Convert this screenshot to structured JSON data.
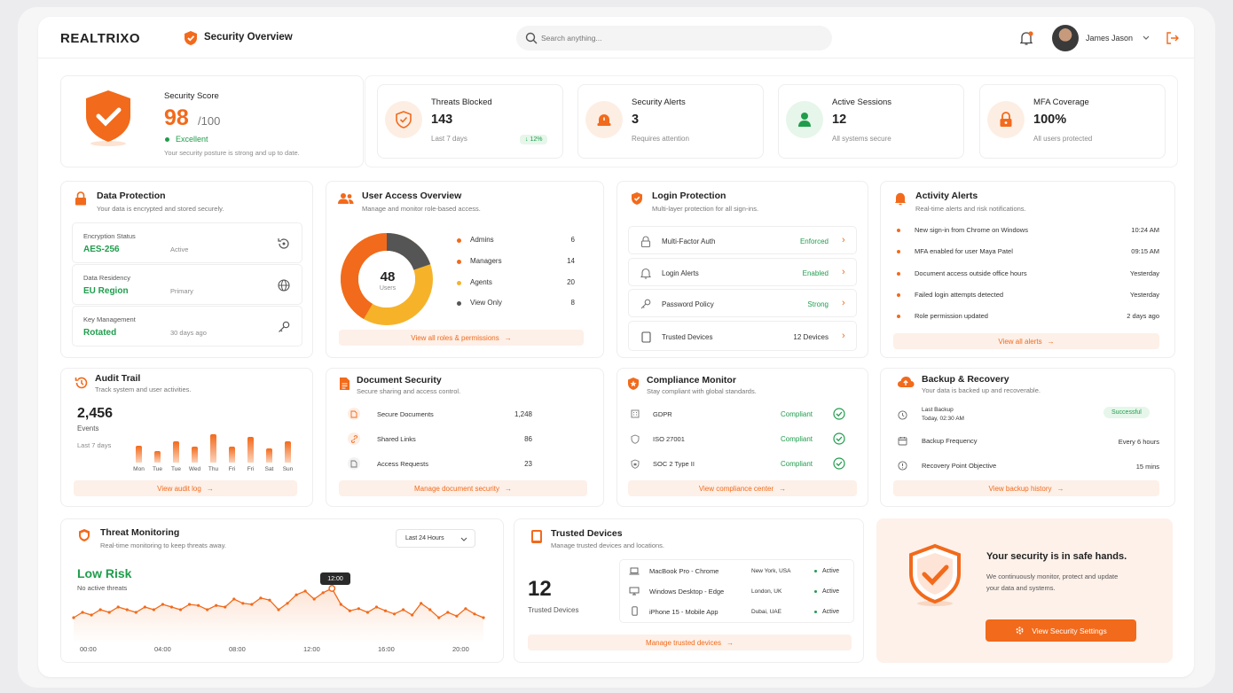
{
  "header": {
    "logo": "REALTRIXO",
    "page_title": "Security Overview",
    "search_placeholder": "Search anything...",
    "user_name": "James Jason"
  },
  "score": {
    "label": "Security Score",
    "value": "98",
    "max": "/100",
    "status": "Excellent",
    "note": "Your security posture is strong and up to date."
  },
  "stats": [
    {
      "title": "Threats Blocked",
      "value": "143",
      "sub": "Last 7 days",
      "badge": "↓ 12%"
    },
    {
      "title": "Security Alerts",
      "value": "3",
      "sub": "Requires attention"
    },
    {
      "title": "Active Sessions",
      "value": "12",
      "sub": "All systems secure"
    },
    {
      "title": "MFA Coverage",
      "value": "100%",
      "sub": "All users protected"
    }
  ],
  "data_protection": {
    "title": "Data Protection",
    "sub": "Your data is encrypted and stored securely.",
    "items": [
      {
        "label": "Encryption Status",
        "value": "AES-256",
        "meta": "Active"
      },
      {
        "label": "Data Residency",
        "value": "EU Region",
        "meta": "Primary"
      },
      {
        "label": "Key Management",
        "value": "Rotated",
        "meta": "30 days ago"
      }
    ]
  },
  "user_access": {
    "title": "User Access Overview",
    "sub": "Manage and monitor role-based access.",
    "total": "48",
    "total_label": "Users",
    "link": "View all roles & permissions",
    "roles": [
      {
        "name": "Admins",
        "count": "6",
        "color": "#f26a1b"
      },
      {
        "name": "Managers",
        "count": "14",
        "color": "#f26a1b"
      },
      {
        "name": "Agents",
        "count": "20",
        "color": "#f6b32a"
      },
      {
        "name": "View Only",
        "count": "8",
        "color": "#555555"
      }
    ]
  },
  "login": {
    "title": "Login Protection",
    "sub": "Multi-layer protection for all sign-ins.",
    "items": [
      {
        "label": "Multi-Factor Auth",
        "status": "Enforced"
      },
      {
        "label": "Login Alerts",
        "status": "Enabled"
      },
      {
        "label": "Password Policy",
        "status": "Strong"
      },
      {
        "label": "Trusted Devices",
        "status": "12 Devices"
      }
    ]
  },
  "activity": {
    "title": "Activity Alerts",
    "sub": "Real-time alerts and risk notifications.",
    "link": "View all alerts",
    "items": [
      {
        "text": "New sign-in from Chrome on Windows",
        "time": "10:24 AM"
      },
      {
        "text": "MFA enabled for user Maya Patel",
        "time": "09:15 AM"
      },
      {
        "text": "Document access outside office hours",
        "time": "Yesterday"
      },
      {
        "text": "Failed login attempts detected",
        "time": "Yesterday"
      },
      {
        "text": "Role permission updated",
        "time": "2 days ago"
      }
    ]
  },
  "audit": {
    "title": "Audit Trail",
    "sub": "Track system and user activities.",
    "count": "2,456",
    "count_label": "Events",
    "period": "Last 7 days",
    "link": "View audit log",
    "days": [
      "Mon",
      "Tue",
      "Tue",
      "Wed",
      "Thu",
      "Fri",
      "Fri",
      "Sat",
      "Sun"
    ],
    "values": [
      0.6,
      0.4,
      0.75,
      0.55,
      1.0,
      0.55,
      0.9,
      0.5,
      0.75
    ]
  },
  "documents": {
    "title": "Document Security",
    "sub": "Secure sharing and access control.",
    "link": "Manage document security",
    "items": [
      {
        "label": "Secure Documents",
        "value": "1,248"
      },
      {
        "label": "Shared Links",
        "value": "86"
      },
      {
        "label": "Access Requests",
        "value": "23"
      }
    ]
  },
  "compliance": {
    "title": "Compliance Monitor",
    "sub": "Stay compliant with global standards.",
    "link": "View compliance center",
    "items": [
      {
        "label": "GDPR",
        "status": "Compliant"
      },
      {
        "label": "ISO 27001",
        "status": "Compliant"
      },
      {
        "label": "SOC 2 Type II",
        "status": "Compliant"
      }
    ]
  },
  "backup": {
    "title": "Backup & Recovery",
    "sub": "Your data is backed up and recoverable.",
    "link": "View backup history",
    "last_label": "Last Backup",
    "last_time": "Today, 02:30 AM",
    "last_status": "Successful",
    "items": [
      {
        "label": "Backup Frequency",
        "value": "Every 6 hours"
      },
      {
        "label": "Recovery Point Objective",
        "value": "15 mins"
      }
    ]
  },
  "threat": {
    "title": "Threat Monitoring",
    "sub": "Real-time monitoring to keep threats away.",
    "range": "Last 24 Hours",
    "risk": "Low Risk",
    "risk_sub": "No active threats",
    "tooltip": "12:00",
    "x_labels": [
      "00:00",
      "04:00",
      "08:00",
      "12:00",
      "16:00",
      "20:00"
    ],
    "values": [
      0.35,
      0.45,
      0.4,
      0.5,
      0.45,
      0.55,
      0.5,
      0.45,
      0.55,
      0.5,
      0.6,
      0.55,
      0.5,
      0.6,
      0.58,
      0.5,
      0.58,
      0.55,
      0.7,
      0.62,
      0.6,
      0.72,
      0.68,
      0.5,
      0.62,
      0.78,
      0.85,
      0.7,
      0.82,
      0.9,
      0.6,
      0.48,
      0.52,
      0.45,
      0.55,
      0.48,
      0.42,
      0.5,
      0.4,
      0.62,
      0.5,
      0.35,
      0.45,
      0.38,
      0.52,
      0.42,
      0.35
    ]
  },
  "trusted": {
    "title": "Trusted Devices",
    "sub": "Manage trusted devices and locations.",
    "count": "12",
    "count_label": "Trusted Devices",
    "link": "Manage trusted devices",
    "devices": [
      {
        "name": "MacBook Pro - Chrome",
        "loc": "New York, USA",
        "status": "Active"
      },
      {
        "name": "Windows Desktop - Edge",
        "loc": "London, UK",
        "status": "Active"
      },
      {
        "name": "iPhone 15 - Mobile App",
        "loc": "Dubai, UAE",
        "status": "Active"
      }
    ]
  },
  "safe": {
    "title": "Your security is in safe hands.",
    "text1": "We continuously monitor, protect and update",
    "text2": "your data and systems.",
    "button": "View Security Settings"
  },
  "colors": {
    "accent": "#f26a1b",
    "success": "#1f9d4c",
    "warning": "#f6b32a"
  }
}
